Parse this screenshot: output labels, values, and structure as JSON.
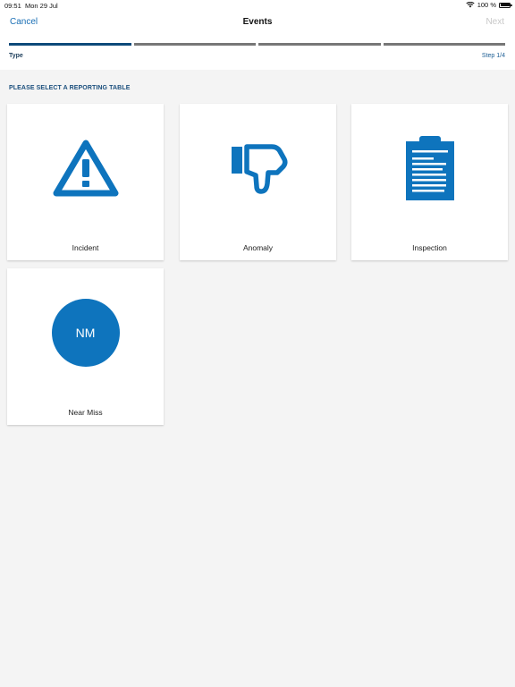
{
  "status_bar": {
    "time": "09:51",
    "date": "Mon 29 Jul",
    "battery_text": "100 %",
    "battery_level": 1.0,
    "wifi_icon": "wifi-icon"
  },
  "navbar": {
    "cancel_label": "Cancel",
    "title": "Events",
    "next_label": "Next"
  },
  "progress": {
    "current_step": 1,
    "total_steps": 4,
    "type_label": "Type",
    "step_label": "Step 1/4"
  },
  "section_title": "PLEASE SELECT A REPORTING TABLE",
  "cards": [
    {
      "label": "Incident",
      "icon": "warning-triangle-icon"
    },
    {
      "label": "Anomaly",
      "icon": "thumbs-down-icon"
    },
    {
      "label": "Inspection",
      "icon": "clipboard-icon"
    },
    {
      "label": "Near Miss",
      "icon": "near-miss-badge",
      "badge_text": "NM"
    }
  ],
  "colors": {
    "accent": "#0e74bd",
    "link": "#1a6fb5",
    "progress_active": "#0e4a7a",
    "progress_inactive": "#777777",
    "background": "#f4f4f4"
  }
}
